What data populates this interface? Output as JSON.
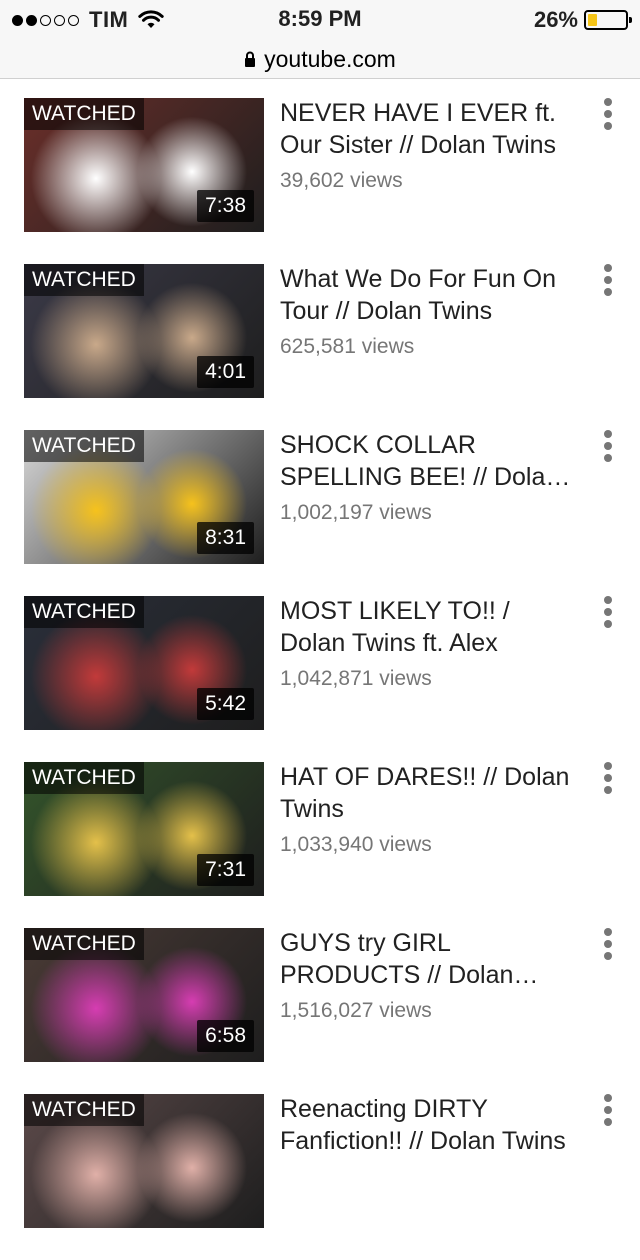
{
  "status_bar": {
    "carrier": "TIM",
    "signal_bars_filled": 2,
    "signal_bars_total": 5,
    "time": "8:59 PM",
    "battery_percent": "26%",
    "battery_level": 0.26,
    "battery_color": "#f5c518",
    "wifi_icon": "wifi-icon"
  },
  "url_bar": {
    "lock_icon": "lock-icon",
    "url": "youtube.com"
  },
  "videos": [
    {
      "title": "NEVER HAVE I EVER ft. Our Sister // Dolan Twins",
      "views": "39,602 views",
      "duration": "7:38",
      "watched_label": "WATCHED",
      "thumb_colors": [
        "#6b2f2a",
        "#ffffff"
      ]
    },
    {
      "title": "What We Do For Fun On Tour // Dolan Twins",
      "views": "625,581 views",
      "duration": "4:01",
      "watched_label": "WATCHED",
      "thumb_colors": [
        "#3b3a48",
        "#c9a98a"
      ]
    },
    {
      "title": "SHOCK COLLAR SPELLING BEE! // Dolan Twins",
      "views": "1,002,197 views",
      "duration": "8:31",
      "watched_label": "WATCHED",
      "thumb_colors": [
        "#d9d9d9",
        "#f6c21c"
      ]
    },
    {
      "title": "MOST LIKELY TO!! / Dolan Twins ft. Alex",
      "views": "1,042,871 views",
      "duration": "5:42",
      "watched_label": "WATCHED",
      "thumb_colors": [
        "#2a2f3a",
        "#c23a3a"
      ]
    },
    {
      "title": "HAT OF DARES!! // Dolan Twins",
      "views": "1,033,940 views",
      "duration": "7:31",
      "watched_label": "WATCHED",
      "thumb_colors": [
        "#34552b",
        "#e4c04a"
      ]
    },
    {
      "title": "GUYS try GIRL PRODUCTS // Dolan Twins",
      "views": "1,516,027 views",
      "duration": "6:58",
      "watched_label": "WATCHED",
      "thumb_colors": [
        "#4a3b36",
        "#d63db2"
      ]
    },
    {
      "title": "Reenacting DIRTY Fanfiction!! // Dolan Twins",
      "views": "",
      "duration": "",
      "watched_label": "WATCHED",
      "thumb_colors": [
        "#5c4a4a",
        "#e0b0a8"
      ]
    }
  ]
}
